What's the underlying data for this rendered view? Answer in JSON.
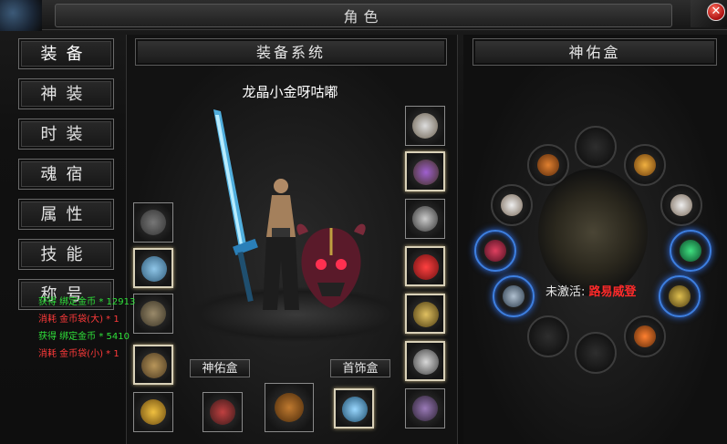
{
  "window": {
    "title": "角色",
    "close_icon": "close-icon"
  },
  "tabs": [
    {
      "label": "装备",
      "active": true
    },
    {
      "label": "神装"
    },
    {
      "label": "时装"
    },
    {
      "label": "魂宿"
    },
    {
      "label": "属性"
    },
    {
      "label": "技能"
    },
    {
      "label": "称号"
    }
  ],
  "equipment": {
    "header": "装备系统",
    "character_name": "龙晶小金呀咕嘟",
    "label_box_left": "神佑盒",
    "label_box_right": "首饰盒",
    "slots_left": [
      "ghost-icon",
      "ice-wing-icon",
      "bone-armor-icon",
      "dragon-bracelet-icon",
      "gold-ring-icon"
    ],
    "slots_right": [
      "skull-helmet-icon",
      "claw-necklace-icon",
      "chain-icon",
      "red-potion-icon",
      "gold-bracelet-icon",
      "orb-icon",
      "bat-wing-icon"
    ],
    "slots_bottom": [
      "red-boots-icon",
      "gourd-icon",
      "blue-gem-icon"
    ]
  },
  "god_box": {
    "header": "神佑盒",
    "status_label": "未激活:",
    "status_value": "路易威登",
    "ring_slots": [
      "bracelet-icon",
      "feather-icon",
      "bowl-icon",
      "bowl-icon",
      "ruby-gem-icon",
      "emerald-gem-icon",
      "blue-orb-icon",
      "gold-orb-icon",
      "fire-orb-icon",
      "empty-slot",
      "empty-slot",
      "empty-slot"
    ]
  },
  "log": [
    {
      "type": "gain",
      "text": "获得 绑定金币 * 12913"
    },
    {
      "type": "cost",
      "text": "消耗 金币袋(大) * 1"
    },
    {
      "type": "gain",
      "text": "获得 绑定金币 * 5410"
    },
    {
      "type": "cost",
      "text": "消耗 金币袋(小) * 1"
    }
  ]
}
